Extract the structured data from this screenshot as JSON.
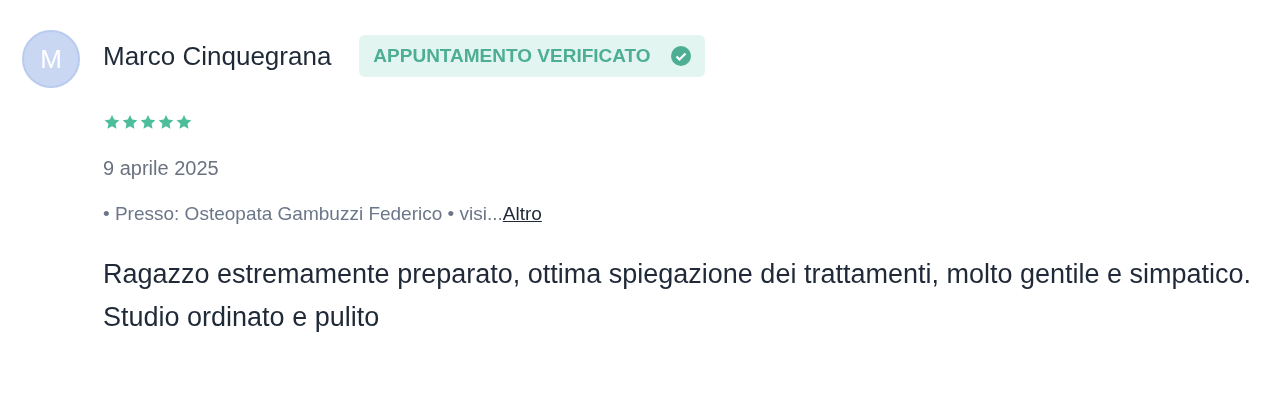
{
  "review": {
    "avatar_letter": "M",
    "author": "Marco Cinquegrana",
    "badge": {
      "label": "APPUNTAMENTO VERIFICATO",
      "verified": true
    },
    "stars": 5,
    "date": "9 aprile 2025",
    "meta": "• Presso: Osteopata Gambuzzi Federico • visi...",
    "more_link": "Altro",
    "paragraphs": [
      "Ragazzo estremamente preparato, ottima spiegazione dei trattamenti, molto gentile e simpatico.",
      "Studio ordinato e pulito"
    ]
  }
}
